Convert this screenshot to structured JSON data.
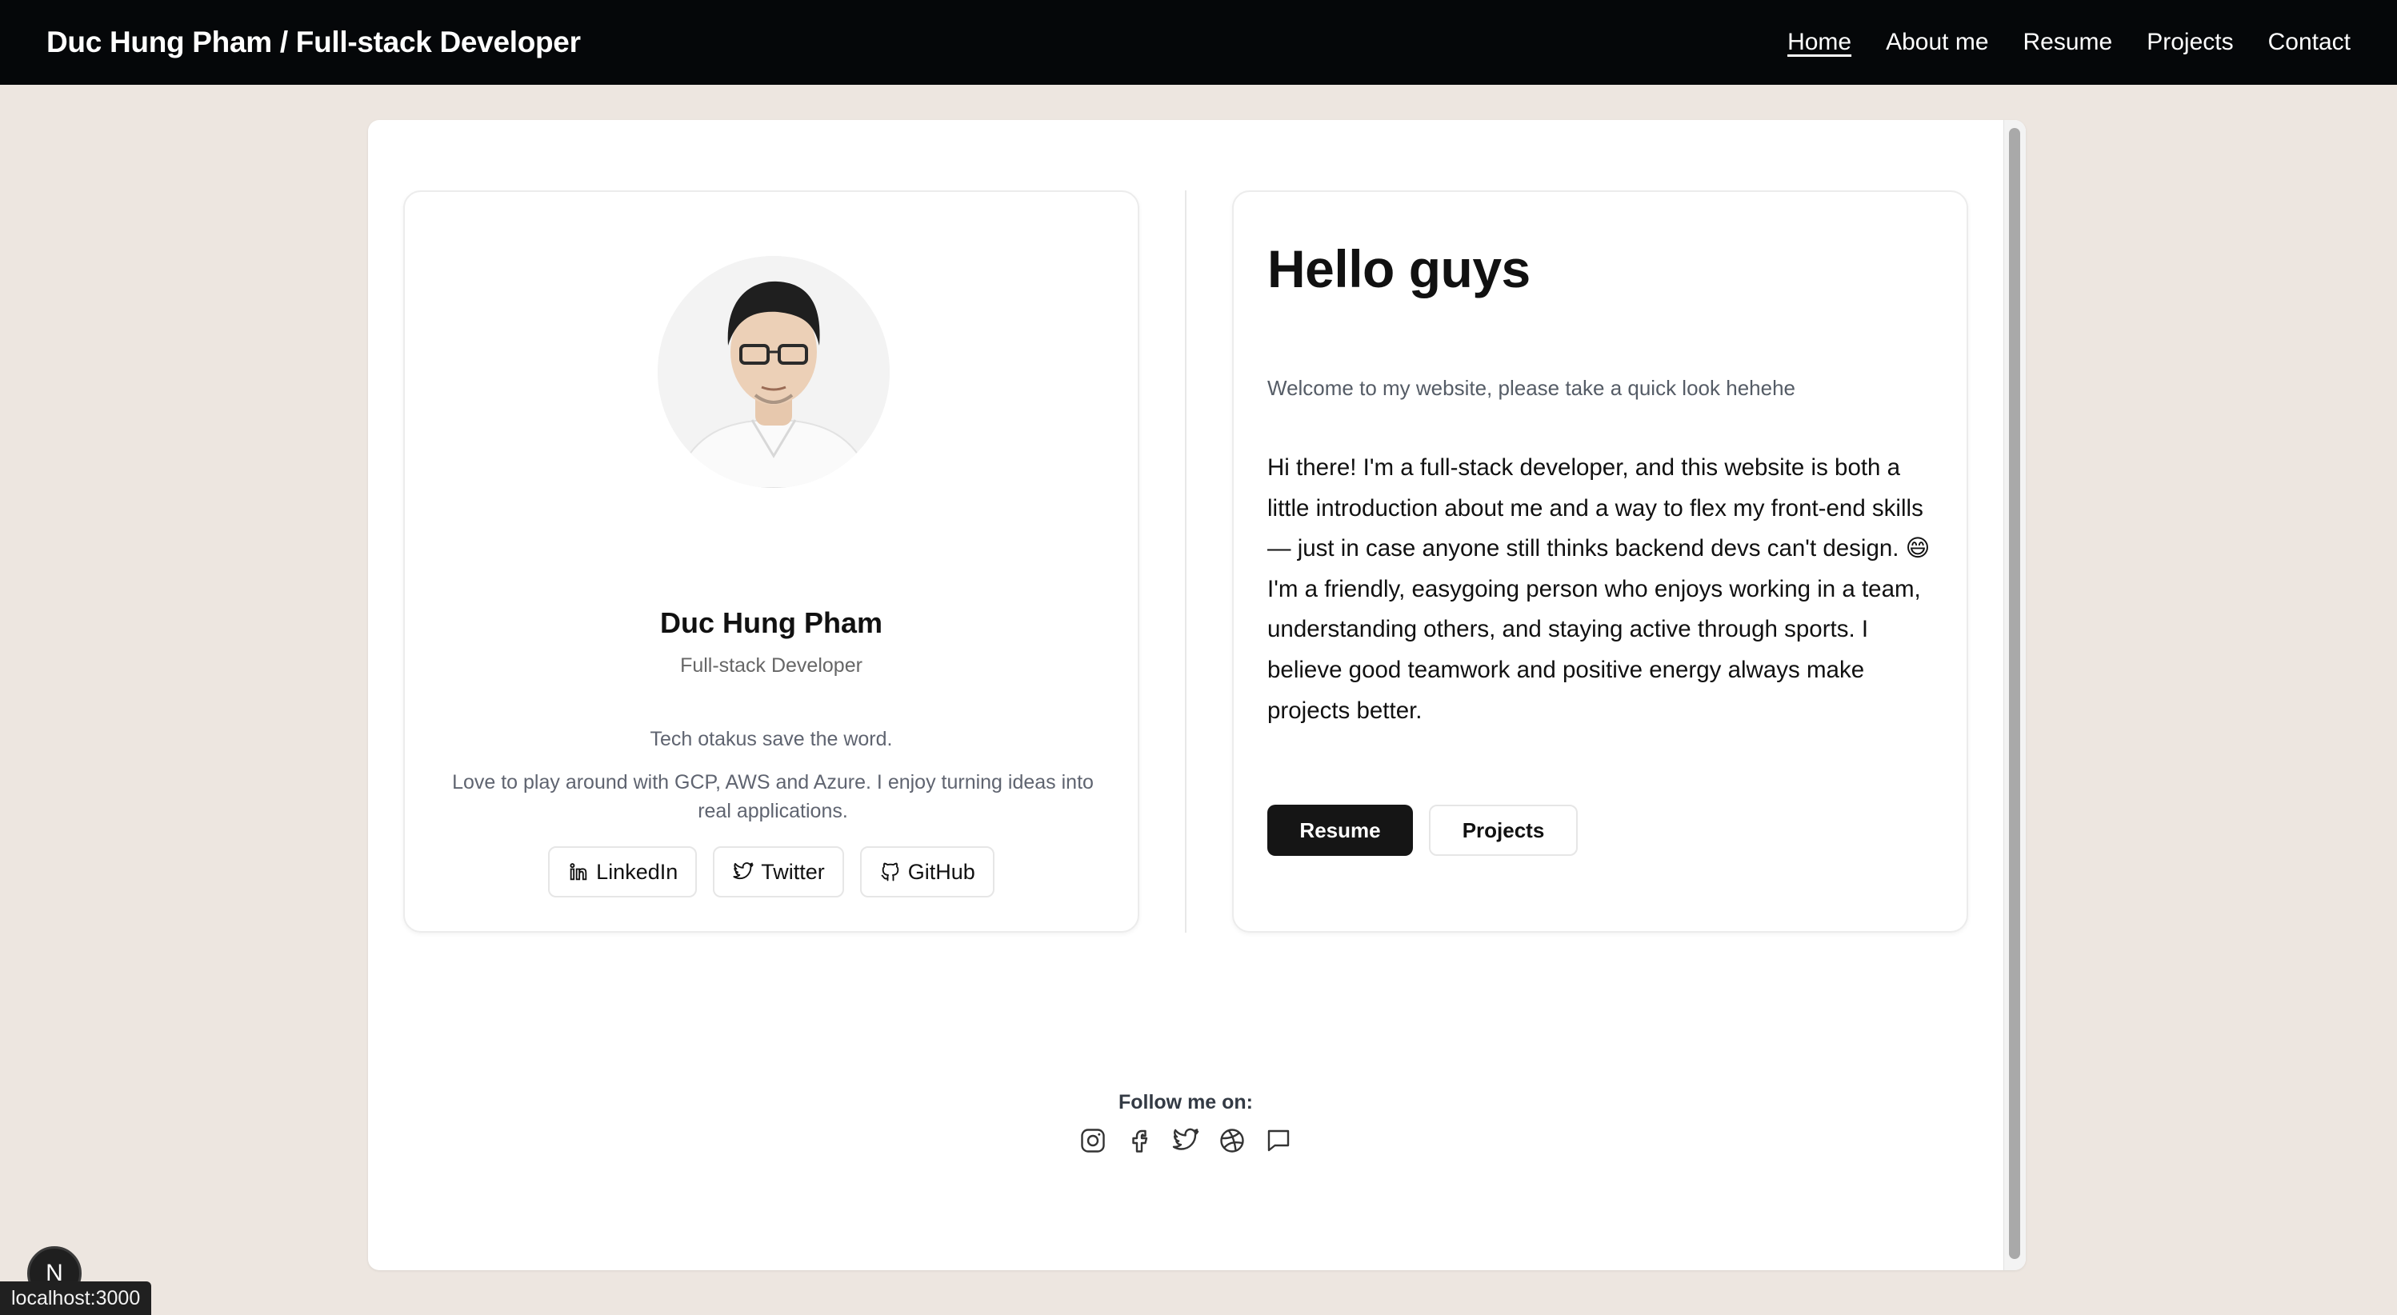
{
  "header": {
    "brand": "Duc Hung Pham / Full-stack Developer",
    "nav": [
      {
        "label": "Home",
        "active": true
      },
      {
        "label": "About me"
      },
      {
        "label": "Resume"
      },
      {
        "label": "Projects"
      },
      {
        "label": "Contact"
      }
    ]
  },
  "profile": {
    "name": "Duc Hung Pham",
    "role": "Full-stack Developer",
    "tagline": "Tech otakus save the word.",
    "bio": "Love to play around with GCP, AWS and Azure. I enjoy turning ideas into real applications.",
    "social": [
      {
        "label": "LinkedIn",
        "icon": "linkedin-icon"
      },
      {
        "label": "Twitter",
        "icon": "twitter-icon"
      },
      {
        "label": "GitHub",
        "icon": "github-icon"
      }
    ]
  },
  "intro": {
    "heading": "Hello guys",
    "subheading": "Welcome to my website, please take a quick look hehehe",
    "body": "Hi there! I'm a full-stack developer, and this website is both a little introduction about me and a way to flex my front-end skills — just in case anyone still thinks backend devs can't design. 😄 I'm a friendly, easygoing person who enjoys working in a team, understanding others, and staying active through sports. I believe good teamwork and positive energy always make projects better.",
    "primary_button": "Resume",
    "secondary_button": "Projects"
  },
  "footer": {
    "follow_label": "Follow me on:",
    "icons": [
      "instagram-icon",
      "facebook-icon",
      "twitter-icon",
      "dribbble-icon",
      "chat-icon"
    ]
  },
  "dev": {
    "badge": "N",
    "status_url": "localhost:3000"
  },
  "colors": {
    "page_bg": "#ede6e0",
    "nav_bg": "#050709",
    "primary_button": "#151515"
  }
}
